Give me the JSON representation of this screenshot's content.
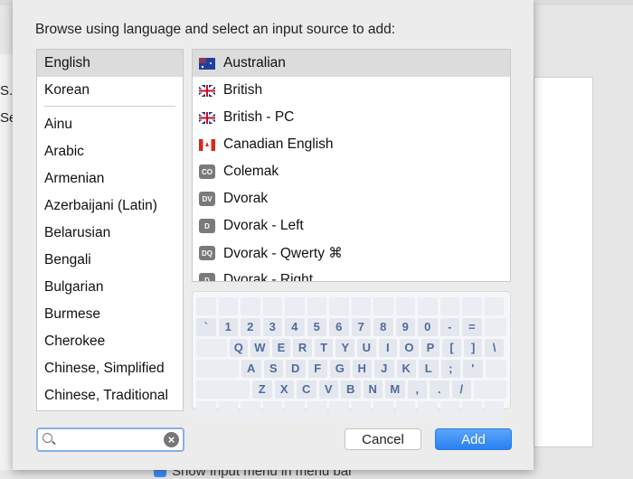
{
  "background": {
    "left_text": [
      "S.",
      "Se"
    ],
    "bottom_text": "Show Input menu in menu bar"
  },
  "dialog": {
    "title": "Browse using language and select an input source to add:",
    "languages_top": [
      "English",
      "Korean"
    ],
    "languages": [
      "Ainu",
      "Arabic",
      "Armenian",
      "Azerbaijani (Latin)",
      "Belarusian",
      "Bengali",
      "Bulgarian",
      "Burmese",
      "Cherokee",
      "Chinese, Simplified",
      "Chinese, Traditional"
    ],
    "selected_language": "English",
    "sources": [
      {
        "label": "Australian",
        "icon": "flag-australia",
        "badge": ""
      },
      {
        "label": "British",
        "icon": "flag-uk",
        "badge": ""
      },
      {
        "label": "British - PC",
        "icon": "flag-uk-pc",
        "badge": "PC"
      },
      {
        "label": "Canadian English",
        "icon": "flag-canada",
        "badge": ""
      },
      {
        "label": "Colemak",
        "icon": "badge",
        "badge": "CO"
      },
      {
        "label": "Dvorak",
        "icon": "badge",
        "badge": "DV"
      },
      {
        "label": "Dvorak - Left",
        "icon": "badge",
        "badge": "D"
      },
      {
        "label": "Dvorak - Qwerty ⌘",
        "icon": "badge",
        "badge": "DQ"
      },
      {
        "label": "Dvorak - Right",
        "icon": "badge",
        "badge": "D"
      }
    ],
    "selected_source": "Australian",
    "keyboard": [
      [
        "`",
        "1",
        "2",
        "3",
        "4",
        "5",
        "6",
        "7",
        "8",
        "9",
        "0",
        "-",
        "="
      ],
      [
        "Q",
        "W",
        "E",
        "R",
        "T",
        "Y",
        "U",
        "I",
        "O",
        "P",
        "[",
        "]",
        "\\"
      ],
      [
        "A",
        "S",
        "D",
        "F",
        "G",
        "H",
        "J",
        "K",
        "L",
        ";",
        "'"
      ],
      [
        "Z",
        "X",
        "C",
        "V",
        "B",
        "N",
        "M",
        ",",
        ".",
        "/"
      ]
    ],
    "search": {
      "value": "",
      "placeholder": ""
    },
    "cancel_label": "Cancel",
    "add_label": "Add",
    "colors": {
      "accent": "#2a80f0",
      "key_text": "#4f6b9e"
    }
  }
}
